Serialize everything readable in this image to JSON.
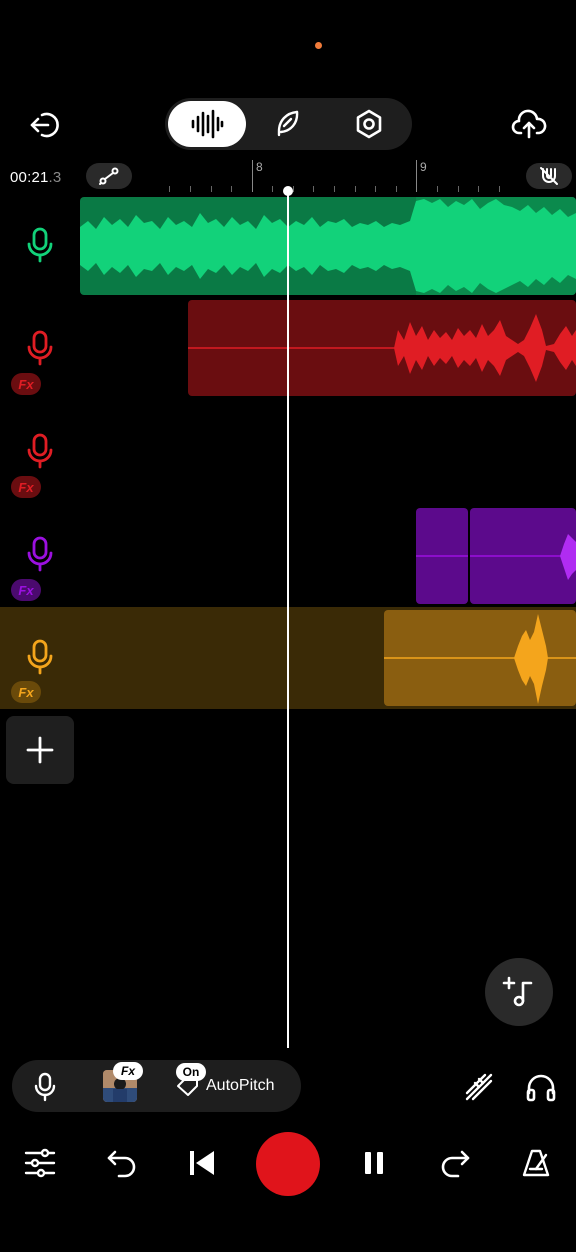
{
  "status": {
    "indicator_color": "#f07b3a"
  },
  "header": {
    "back_icon": "exit-icon",
    "upload_icon": "cloud-upload-icon",
    "modes": [
      {
        "name": "waveform-icon",
        "active": true
      },
      {
        "name": "feather-icon",
        "active": false
      },
      {
        "name": "settings-hexagon-icon",
        "active": false
      }
    ]
  },
  "ruler": {
    "time_main": "00:21",
    "time_ms": ".3",
    "bars": [
      "8",
      "9"
    ]
  },
  "tracks": [
    {
      "color": "#12d27a",
      "fx": false,
      "fx_label": ""
    },
    {
      "color": "#e01d24",
      "fx": true,
      "fx_label": "Fx"
    },
    {
      "color": "#e01d24",
      "fx": true,
      "fx_label": "Fx"
    },
    {
      "color": "#9b10e0",
      "fx": true,
      "fx_label": "Fx"
    },
    {
      "color": "#f4a51c",
      "fx": true,
      "fx_label": "Fx"
    }
  ],
  "bottom": {
    "fx_label": "Fx",
    "on_label": "On",
    "autopitch_label": "AutoPitch"
  },
  "colors": {
    "record": "#e0141b",
    "selected_track_bg": "#3a2a06"
  }
}
